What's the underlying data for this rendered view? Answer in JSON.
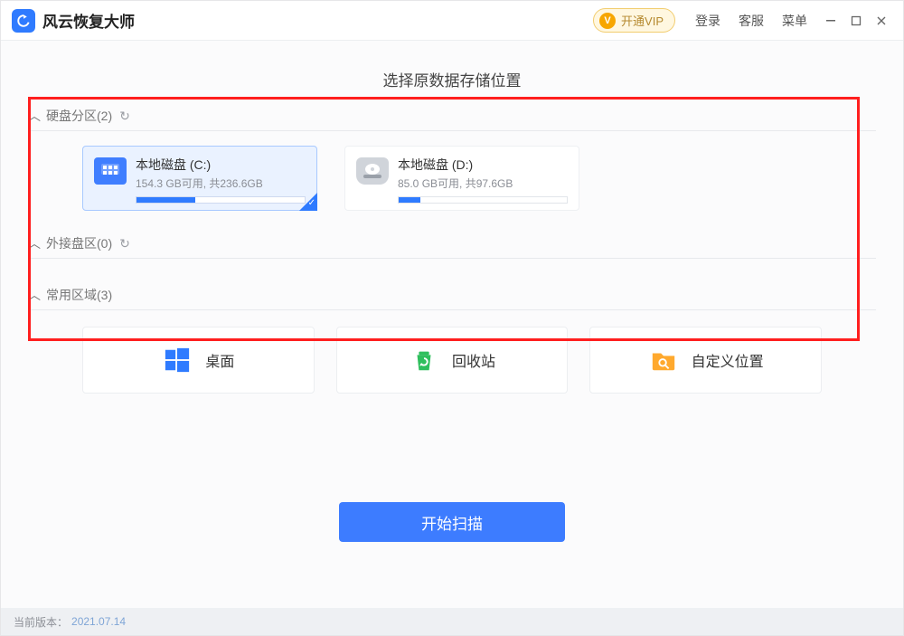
{
  "header": {
    "app_title": "风云恢复大师",
    "vip_label": "开通VIP",
    "vip_badge": "V",
    "login": "登录",
    "support": "客服",
    "menu": "菜单"
  },
  "main": {
    "title": "选择原数据存储位置",
    "hdd_section": {
      "label": "硬盘分区",
      "count": "2"
    },
    "ext_section": {
      "label": "外接盘区",
      "count": "0"
    },
    "common_section": {
      "label": "常用区域",
      "count": "3"
    },
    "drives": [
      {
        "name": "本地磁盘 (C:)",
        "sub": "154.3 GB可用, 共236.6GB",
        "fill_pct": 35,
        "selected": true,
        "icon": "ssd"
      },
      {
        "name": "本地磁盘 (D:)",
        "sub": "85.0 GB可用, 共97.6GB",
        "fill_pct": 13,
        "selected": false,
        "icon": "hdd"
      }
    ],
    "common": [
      {
        "label": "桌面",
        "icon": "desktop",
        "color": "#2f7bff"
      },
      {
        "label": "回收站",
        "icon": "recycle",
        "color": "#2fbf5d"
      },
      {
        "label": "自定义位置",
        "icon": "folder",
        "color": "#ffa92e"
      }
    ],
    "scan_button": "开始扫描"
  },
  "footer": {
    "label": "当前版本：",
    "version": "2021.07.14"
  }
}
